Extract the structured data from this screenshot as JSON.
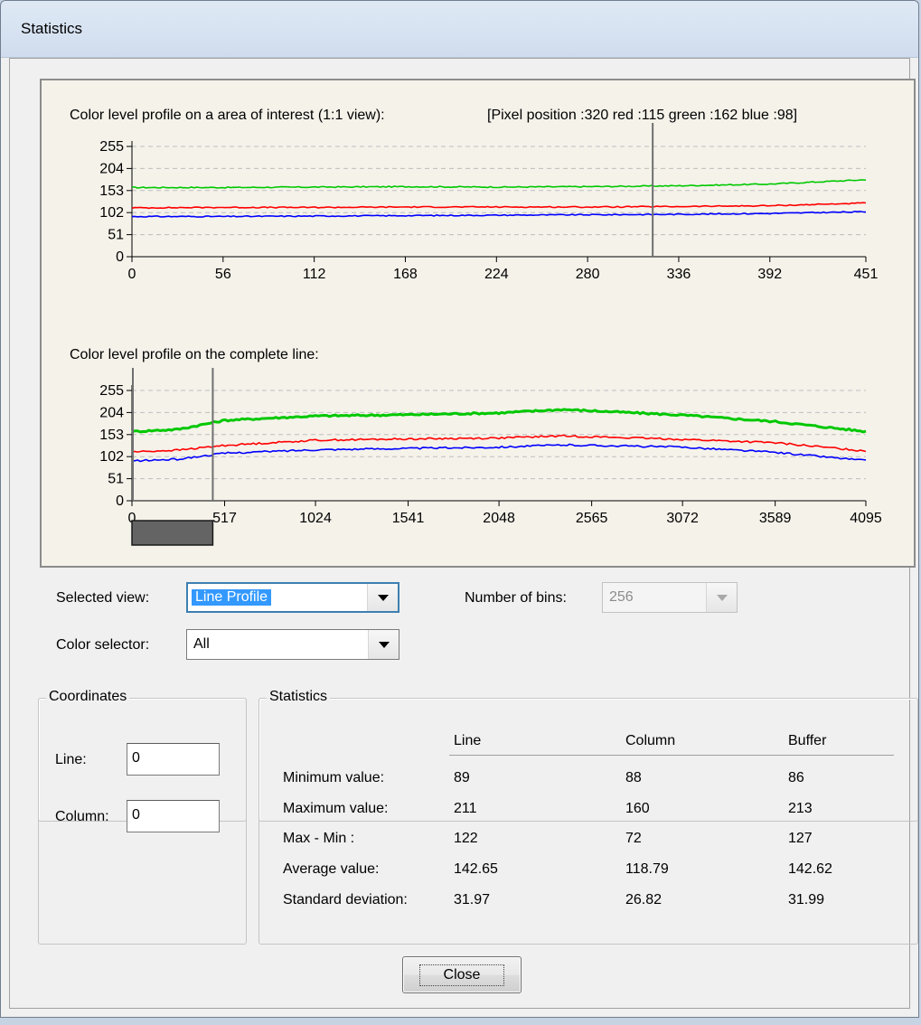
{
  "window": {
    "title": "Statistics"
  },
  "charts": {
    "top": {
      "title": "Color level profile on a area of interest (1:1 view):",
      "pixel_info": "[Pixel position :320  red :115 green :162 blue :98]"
    },
    "bottom": {
      "title": "Color level profile on the complete line:"
    }
  },
  "chart_data": [
    {
      "type": "line",
      "title": "Color level profile on a area of interest (1:1 view):",
      "x_ticks": [
        "0",
        "56",
        "112",
        "168",
        "224",
        "280",
        "336",
        "392",
        "451"
      ],
      "y_ticks": [
        "0",
        "51",
        "102",
        "153",
        "204",
        "255"
      ],
      "xlim": [
        0,
        451
      ],
      "ylim": [
        0,
        255
      ],
      "grid": "horizontal dashed",
      "cursor_x": 320,
      "series": [
        {
          "color": "#00c800",
          "x": [
            0,
            56,
            112,
            168,
            224,
            280,
            336,
            392,
            451
          ],
          "values": [
            160,
            160,
            161,
            162,
            161,
            162,
            164,
            168,
            178
          ]
        },
        {
          "color": "#ff0000",
          "x": [
            0,
            56,
            112,
            168,
            224,
            280,
            336,
            392,
            451
          ],
          "values": [
            113,
            114,
            114,
            115,
            115,
            115,
            116,
            118,
            124
          ]
        },
        {
          "color": "#0000ff",
          "x": [
            0,
            56,
            112,
            168,
            224,
            280,
            336,
            392,
            451
          ],
          "values": [
            93,
            93,
            94,
            95,
            96,
            97,
            98,
            100,
            104
          ]
        }
      ]
    },
    {
      "type": "line",
      "title": "Color level profile on the complete line:",
      "x_ticks": [
        "0",
        "517",
        "1024",
        "1541",
        "2048",
        "2565",
        "3072",
        "3589",
        "4095"
      ],
      "y_ticks": [
        "0",
        "51",
        "102",
        "153",
        "204",
        "255"
      ],
      "xlim": [
        0,
        4095
      ],
      "ylim": [
        0,
        255
      ],
      "grid": "horizontal dashed",
      "cursor_x": 451,
      "series": [
        {
          "color": "#00c800",
          "x": [
            0,
            256,
            517,
            1024,
            1541,
            2048,
            2400,
            2565,
            3072,
            3589,
            4095
          ],
          "values": [
            160,
            165,
            186,
            196,
            199,
            203,
            211,
            208,
            198,
            183,
            160
          ]
        },
        {
          "color": "#ff0000",
          "x": [
            0,
            256,
            517,
            1024,
            1541,
            2048,
            2400,
            2565,
            3072,
            3589,
            4095
          ],
          "values": [
            113,
            117,
            128,
            140,
            143,
            145,
            150,
            148,
            142,
            134,
            115
          ]
        },
        {
          "color": "#0000ff",
          "x": [
            0,
            256,
            517,
            1024,
            1541,
            2048,
            2400,
            2565,
            3072,
            3589,
            4095
          ],
          "values": [
            92,
            96,
            110,
            118,
            121,
            124,
            129,
            128,
            124,
            112,
            93
          ]
        }
      ]
    }
  ],
  "controls": {
    "selected_view_label": "Selected view:",
    "selected_view_value": "Line Profile",
    "number_of_bins_label": "Number of bins:",
    "number_of_bins_value": "256",
    "color_selector_label": "Color selector:",
    "color_selector_value": "All"
  },
  "coordinates": {
    "title": "Coordinates",
    "line_label": "Line:",
    "line_value": "0",
    "column_label": "Column:",
    "column_value": "0"
  },
  "statistics": {
    "title": "Statistics",
    "headers": [
      "Line",
      "Column",
      "Buffer"
    ],
    "rows": [
      {
        "label": "Minimum value:",
        "values": [
          "89",
          "88",
          "86"
        ]
      },
      {
        "label": "Maximum value:",
        "values": [
          "211",
          "160",
          "213"
        ]
      },
      {
        "label": "Max - Min :",
        "values": [
          "122",
          "72",
          "127"
        ]
      },
      {
        "label": "Average value:",
        "values": [
          "142.65",
          "118.79",
          "142.62"
        ]
      },
      {
        "label": "Standard deviation:",
        "values": [
          "31.97",
          "26.82",
          "31.99"
        ]
      }
    ]
  },
  "buttons": {
    "close_label": "Close"
  },
  "colors": {
    "panel_bg": "#f5f2ea",
    "green": "#00c800",
    "red": "#ff0000",
    "blue": "#0000ff",
    "focus_blue": "#3399ff"
  }
}
